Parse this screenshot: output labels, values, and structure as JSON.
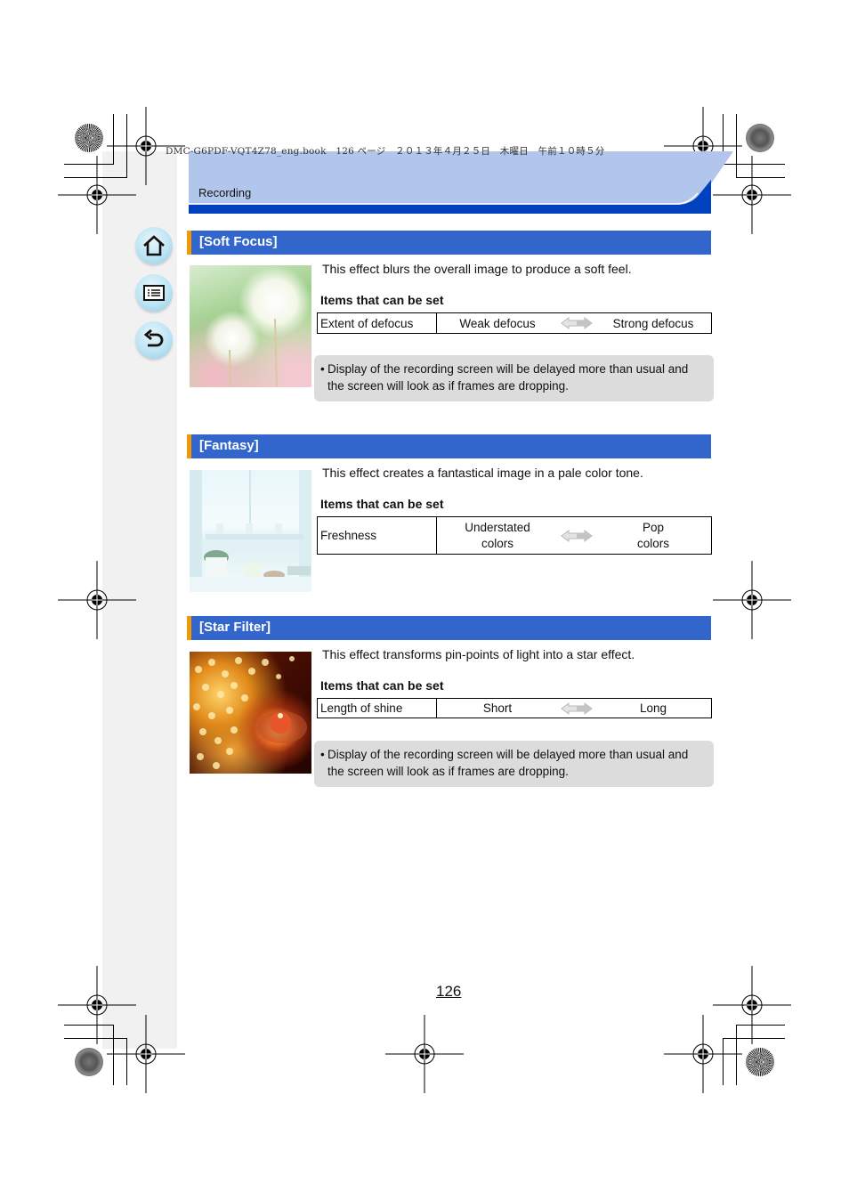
{
  "print_info": "DMC-G6PDF-VQT4Z78_eng.book　126 ページ　２０１３年４月２５日　木曜日　午前１０時５分",
  "header": {
    "title": "Recording"
  },
  "nav": {
    "home_icon": "home-icon",
    "menu_icon": "menu-list-icon",
    "back_icon": "back-arrow-icon"
  },
  "colors": {
    "section_header": "#3366cc",
    "section_accent": "#f39800",
    "header_band_light": "#b2c6ec",
    "header_band_dark": "#0041c0",
    "note_bg": "#dcdcdc",
    "side_strip": "#f1f1f1"
  },
  "sections": [
    {
      "title": "[Soft Focus]",
      "image": "dandelion-photo",
      "description": "This effect blurs the overall image to produce a soft feel.",
      "items_label": "Items that can be set",
      "setting": {
        "name": "Extent of defocus",
        "low": "Weak defocus",
        "high": "Strong defocus",
        "arrow_icon": "double-arrow-icon"
      },
      "note": {
        "line1": "Display of the recording screen will be delayed more than usual and",
        "line2": "the screen will look as if frames are dropping."
      }
    },
    {
      "title": "[Fantasy]",
      "image": "window-sill-photo",
      "description": "This effect creates a fantastical image in a pale color tone.",
      "items_label": "Items that can be set",
      "setting": {
        "name": "Freshness",
        "low_line1": "Understated",
        "low_line2": "colors",
        "high_line1": "Pop",
        "high_line2": "colors",
        "arrow_icon": "double-arrow-icon"
      }
    },
    {
      "title": "[Star Filter]",
      "image": "candle-lights-photo",
      "description": "This effect transforms pin-points of light into a star effect.",
      "items_label": "Items that can be set",
      "setting": {
        "name": "Length of shine",
        "low": "Short",
        "high": "Long",
        "arrow_icon": "double-arrow-icon"
      },
      "note": {
        "line1": "Display of the recording screen will be delayed more than usual and",
        "line2": "the screen will look as if frames are dropping."
      }
    }
  ],
  "page_number": "126"
}
